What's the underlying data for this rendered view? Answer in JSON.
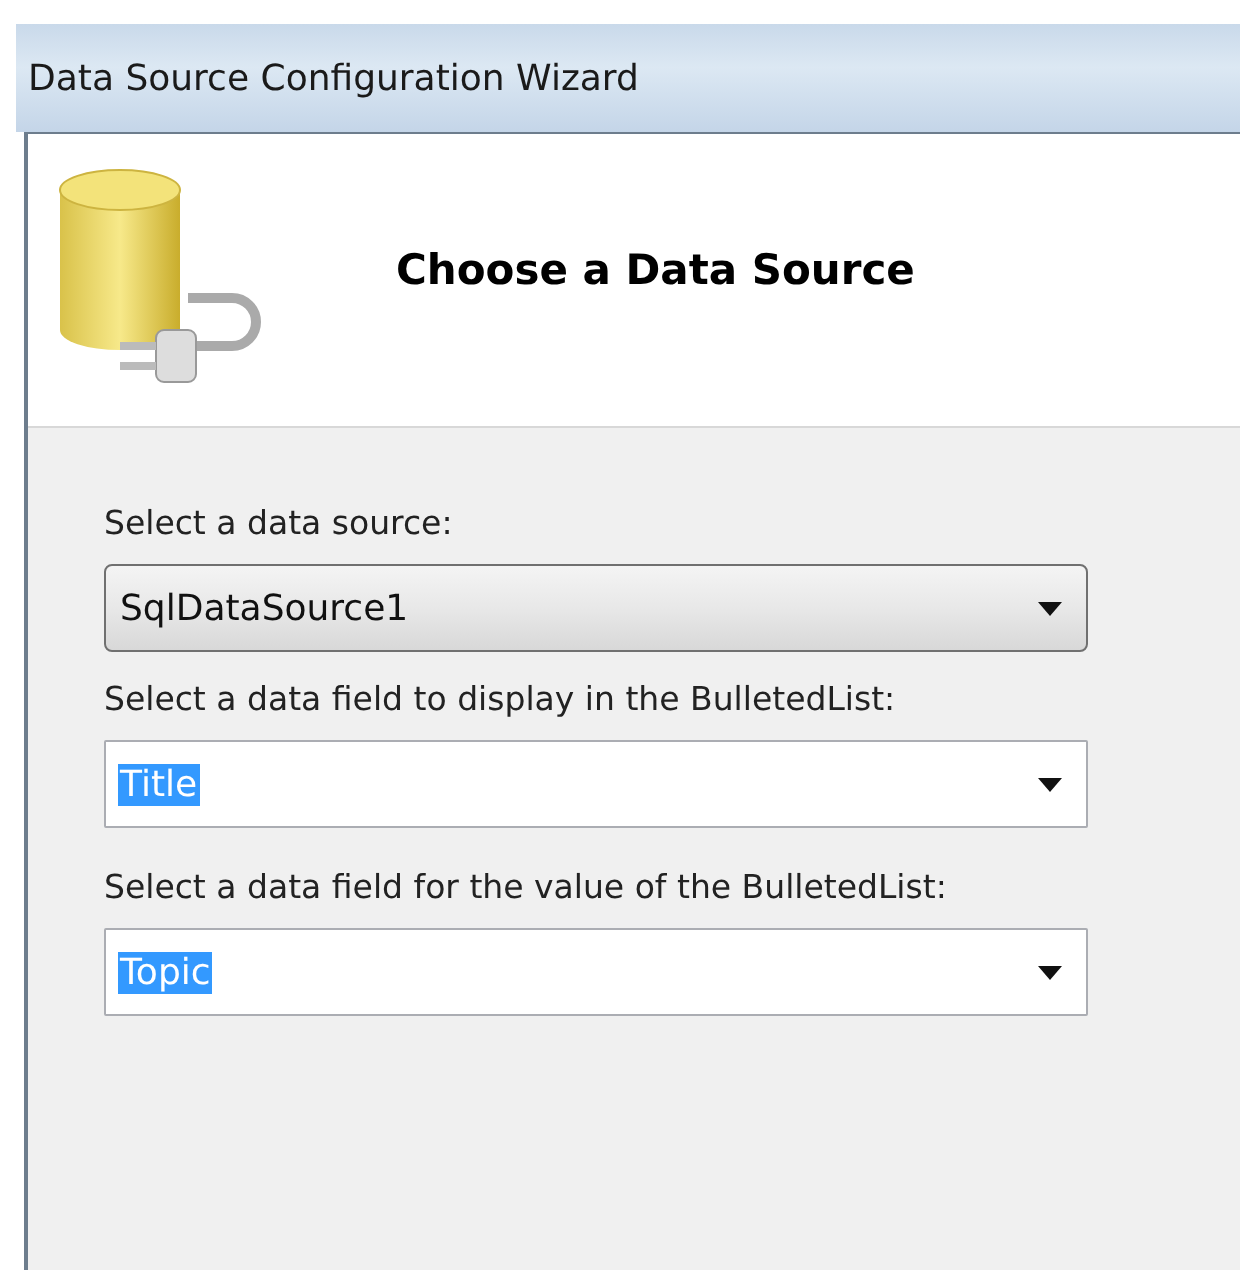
{
  "window": {
    "title": "Data Source Configuration Wizard"
  },
  "header": {
    "title": "Choose a Data Source"
  },
  "fields": [
    {
      "label": "Select a data source:",
      "kind": "button",
      "value": "SqlDataSource1",
      "text_selected": false
    },
    {
      "label": "Select a data field to display in the BulletedList:",
      "kind": "editable",
      "value": "Title",
      "text_selected": true
    },
    {
      "label": "Select a data field for the value of the BulletedList:",
      "kind": "editable",
      "value": "Topic",
      "text_selected": true
    }
  ]
}
